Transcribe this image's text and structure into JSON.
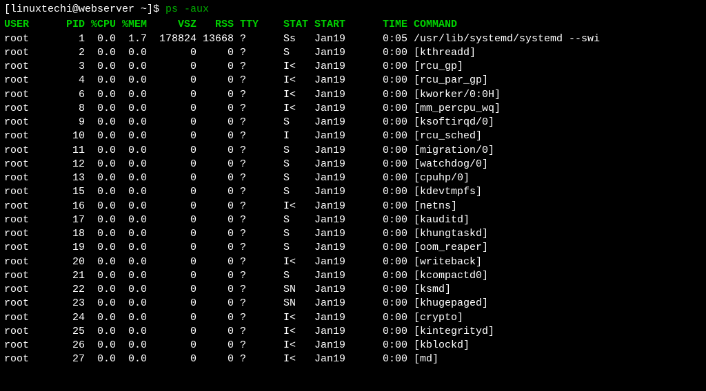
{
  "prompt": {
    "text": "[linuxtechi@webserver ~]$ ",
    "command": "ps -aux"
  },
  "headers": {
    "user": "USER",
    "pid": "PID",
    "cpu": "%CPU",
    "mem": "%MEM",
    "vsz": "VSZ",
    "rss": "RSS",
    "tty": "TTY",
    "stat": "STAT",
    "start": "START",
    "time": "TIME",
    "command": "COMMAND"
  },
  "rows": [
    {
      "user": "root",
      "pid": "1",
      "cpu": "0.0",
      "mem": "1.7",
      "vsz": "178824",
      "rss": "13668",
      "tty": "?",
      "stat": "Ss",
      "start": "Jan19",
      "time": "0:05",
      "command": "/usr/lib/systemd/systemd --swi"
    },
    {
      "user": "root",
      "pid": "2",
      "cpu": "0.0",
      "mem": "0.0",
      "vsz": "0",
      "rss": "0",
      "tty": "?",
      "stat": "S",
      "start": "Jan19",
      "time": "0:00",
      "command": "[kthreadd]"
    },
    {
      "user": "root",
      "pid": "3",
      "cpu": "0.0",
      "mem": "0.0",
      "vsz": "0",
      "rss": "0",
      "tty": "?",
      "stat": "I<",
      "start": "Jan19",
      "time": "0:00",
      "command": "[rcu_gp]"
    },
    {
      "user": "root",
      "pid": "4",
      "cpu": "0.0",
      "mem": "0.0",
      "vsz": "0",
      "rss": "0",
      "tty": "?",
      "stat": "I<",
      "start": "Jan19",
      "time": "0:00",
      "command": "[rcu_par_gp]"
    },
    {
      "user": "root",
      "pid": "6",
      "cpu": "0.0",
      "mem": "0.0",
      "vsz": "0",
      "rss": "0",
      "tty": "?",
      "stat": "I<",
      "start": "Jan19",
      "time": "0:00",
      "command": "[kworker/0:0H]"
    },
    {
      "user": "root",
      "pid": "8",
      "cpu": "0.0",
      "mem": "0.0",
      "vsz": "0",
      "rss": "0",
      "tty": "?",
      "stat": "I<",
      "start": "Jan19",
      "time": "0:00",
      "command": "[mm_percpu_wq]"
    },
    {
      "user": "root",
      "pid": "9",
      "cpu": "0.0",
      "mem": "0.0",
      "vsz": "0",
      "rss": "0",
      "tty": "?",
      "stat": "S",
      "start": "Jan19",
      "time": "0:00",
      "command": "[ksoftirqd/0]"
    },
    {
      "user": "root",
      "pid": "10",
      "cpu": "0.0",
      "mem": "0.0",
      "vsz": "0",
      "rss": "0",
      "tty": "?",
      "stat": "I",
      "start": "Jan19",
      "time": "0:00",
      "command": "[rcu_sched]"
    },
    {
      "user": "root",
      "pid": "11",
      "cpu": "0.0",
      "mem": "0.0",
      "vsz": "0",
      "rss": "0",
      "tty": "?",
      "stat": "S",
      "start": "Jan19",
      "time": "0:00",
      "command": "[migration/0]"
    },
    {
      "user": "root",
      "pid": "12",
      "cpu": "0.0",
      "mem": "0.0",
      "vsz": "0",
      "rss": "0",
      "tty": "?",
      "stat": "S",
      "start": "Jan19",
      "time": "0:00",
      "command": "[watchdog/0]"
    },
    {
      "user": "root",
      "pid": "13",
      "cpu": "0.0",
      "mem": "0.0",
      "vsz": "0",
      "rss": "0",
      "tty": "?",
      "stat": "S",
      "start": "Jan19",
      "time": "0:00",
      "command": "[cpuhp/0]"
    },
    {
      "user": "root",
      "pid": "15",
      "cpu": "0.0",
      "mem": "0.0",
      "vsz": "0",
      "rss": "0",
      "tty": "?",
      "stat": "S",
      "start": "Jan19",
      "time": "0:00",
      "command": "[kdevtmpfs]"
    },
    {
      "user": "root",
      "pid": "16",
      "cpu": "0.0",
      "mem": "0.0",
      "vsz": "0",
      "rss": "0",
      "tty": "?",
      "stat": "I<",
      "start": "Jan19",
      "time": "0:00",
      "command": "[netns]"
    },
    {
      "user": "root",
      "pid": "17",
      "cpu": "0.0",
      "mem": "0.0",
      "vsz": "0",
      "rss": "0",
      "tty": "?",
      "stat": "S",
      "start": "Jan19",
      "time": "0:00",
      "command": "[kauditd]"
    },
    {
      "user": "root",
      "pid": "18",
      "cpu": "0.0",
      "mem": "0.0",
      "vsz": "0",
      "rss": "0",
      "tty": "?",
      "stat": "S",
      "start": "Jan19",
      "time": "0:00",
      "command": "[khungtaskd]"
    },
    {
      "user": "root",
      "pid": "19",
      "cpu": "0.0",
      "mem": "0.0",
      "vsz": "0",
      "rss": "0",
      "tty": "?",
      "stat": "S",
      "start": "Jan19",
      "time": "0:00",
      "command": "[oom_reaper]"
    },
    {
      "user": "root",
      "pid": "20",
      "cpu": "0.0",
      "mem": "0.0",
      "vsz": "0",
      "rss": "0",
      "tty": "?",
      "stat": "I<",
      "start": "Jan19",
      "time": "0:00",
      "command": "[writeback]"
    },
    {
      "user": "root",
      "pid": "21",
      "cpu": "0.0",
      "mem": "0.0",
      "vsz": "0",
      "rss": "0",
      "tty": "?",
      "stat": "S",
      "start": "Jan19",
      "time": "0:00",
      "command": "[kcompactd0]"
    },
    {
      "user": "root",
      "pid": "22",
      "cpu": "0.0",
      "mem": "0.0",
      "vsz": "0",
      "rss": "0",
      "tty": "?",
      "stat": "SN",
      "start": "Jan19",
      "time": "0:00",
      "command": "[ksmd]"
    },
    {
      "user": "root",
      "pid": "23",
      "cpu": "0.0",
      "mem": "0.0",
      "vsz": "0",
      "rss": "0",
      "tty": "?",
      "stat": "SN",
      "start": "Jan19",
      "time": "0:00",
      "command": "[khugepaged]"
    },
    {
      "user": "root",
      "pid": "24",
      "cpu": "0.0",
      "mem": "0.0",
      "vsz": "0",
      "rss": "0",
      "tty": "?",
      "stat": "I<",
      "start": "Jan19",
      "time": "0:00",
      "command": "[crypto]"
    },
    {
      "user": "root",
      "pid": "25",
      "cpu": "0.0",
      "mem": "0.0",
      "vsz": "0",
      "rss": "0",
      "tty": "?",
      "stat": "I<",
      "start": "Jan19",
      "time": "0:00",
      "command": "[kintegrityd]"
    },
    {
      "user": "root",
      "pid": "26",
      "cpu": "0.0",
      "mem": "0.0",
      "vsz": "0",
      "rss": "0",
      "tty": "?",
      "stat": "I<",
      "start": "Jan19",
      "time": "0:00",
      "command": "[kblockd]"
    },
    {
      "user": "root",
      "pid": "27",
      "cpu": "0.0",
      "mem": "0.0",
      "vsz": "0",
      "rss": "0",
      "tty": "?",
      "stat": "I<",
      "start": "Jan19",
      "time": "0:00",
      "command": "[md]"
    }
  ]
}
